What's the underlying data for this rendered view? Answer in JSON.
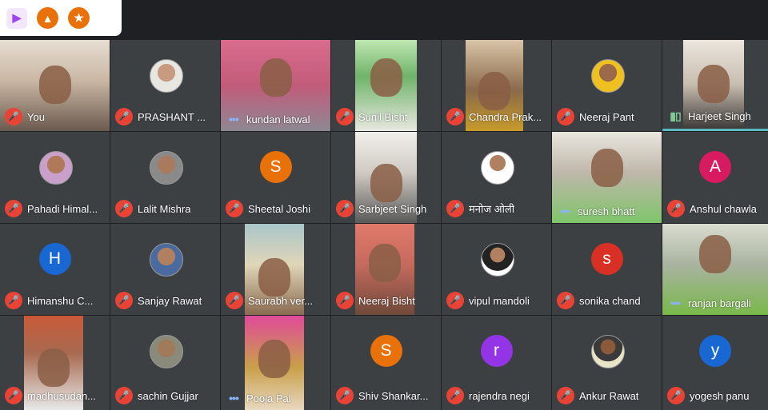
{
  "topbar": {
    "icons": [
      "camera-effects-icon",
      "activities-icon",
      "star-icon"
    ]
  },
  "colors": {
    "muted_red": "#ea4335",
    "speaking_blue": "#8ab4f8",
    "tile_bg": "#3c4043",
    "active_border": "#5bb9c3"
  },
  "participants": [
    {
      "name": "You",
      "mic": "muted",
      "kind": "video"
    },
    {
      "name": "PRASHANT ...",
      "mic": "muted",
      "kind": "photo"
    },
    {
      "name": "kundan latwal",
      "mic": "speaking",
      "kind": "video"
    },
    {
      "name": "Sunil Bisht",
      "mic": "muted",
      "kind": "video"
    },
    {
      "name": "Chandra Prak...",
      "mic": "muted",
      "kind": "video"
    },
    {
      "name": "Neeraj Pant",
      "mic": "muted",
      "kind": "photo"
    },
    {
      "name": "Harjeet Singh",
      "mic": "speaking",
      "kind": "video"
    },
    {
      "name": "Pahadi Himal...",
      "mic": "muted",
      "kind": "photo"
    },
    {
      "name": "Lalit Mishra",
      "mic": "muted",
      "kind": "photo"
    },
    {
      "name": "Sheetal Joshi",
      "mic": "muted",
      "kind": "letter",
      "letter": "S",
      "color": "#e8710a"
    },
    {
      "name": "Sarbjeet Singh",
      "mic": "muted",
      "kind": "video"
    },
    {
      "name": "मनोज ओली",
      "mic": "muted",
      "kind": "photo"
    },
    {
      "name": "suresh bhatt",
      "mic": "speaking",
      "kind": "video"
    },
    {
      "name": "Anshul chawla",
      "mic": "muted",
      "kind": "letter",
      "letter": "A",
      "color": "#d81b60"
    },
    {
      "name": "Himanshu C...",
      "mic": "muted",
      "kind": "letter",
      "letter": "H",
      "color": "#1967d2"
    },
    {
      "name": "Sanjay Rawat",
      "mic": "muted",
      "kind": "photo"
    },
    {
      "name": "Saurabh ver...",
      "mic": "muted",
      "kind": "video"
    },
    {
      "name": "Neeraj Bisht",
      "mic": "muted",
      "kind": "video"
    },
    {
      "name": "vipul mandoli",
      "mic": "muted",
      "kind": "photo"
    },
    {
      "name": "sonika chand",
      "mic": "muted",
      "kind": "letter",
      "letter": "s",
      "color": "#d93025"
    },
    {
      "name": "ranjan bargali",
      "mic": "speaking",
      "kind": "video"
    },
    {
      "name": "madhusudan...",
      "mic": "muted",
      "kind": "video"
    },
    {
      "name": "sachin Gujjar",
      "mic": "muted",
      "kind": "photo"
    },
    {
      "name": "Pooja Pal",
      "mic": "speaking",
      "kind": "video"
    },
    {
      "name": "Shiv Shankar...",
      "mic": "muted",
      "kind": "letter",
      "letter": "S",
      "color": "#e8710a"
    },
    {
      "name": "rajendra negi",
      "mic": "muted",
      "kind": "letter",
      "letter": "r",
      "color": "#9334e6"
    },
    {
      "name": "Ankur Rawat",
      "mic": "muted",
      "kind": "photo"
    },
    {
      "name": "yogesh panu",
      "mic": "muted",
      "kind": "letter",
      "letter": "y",
      "color": "#1967d2"
    }
  ]
}
